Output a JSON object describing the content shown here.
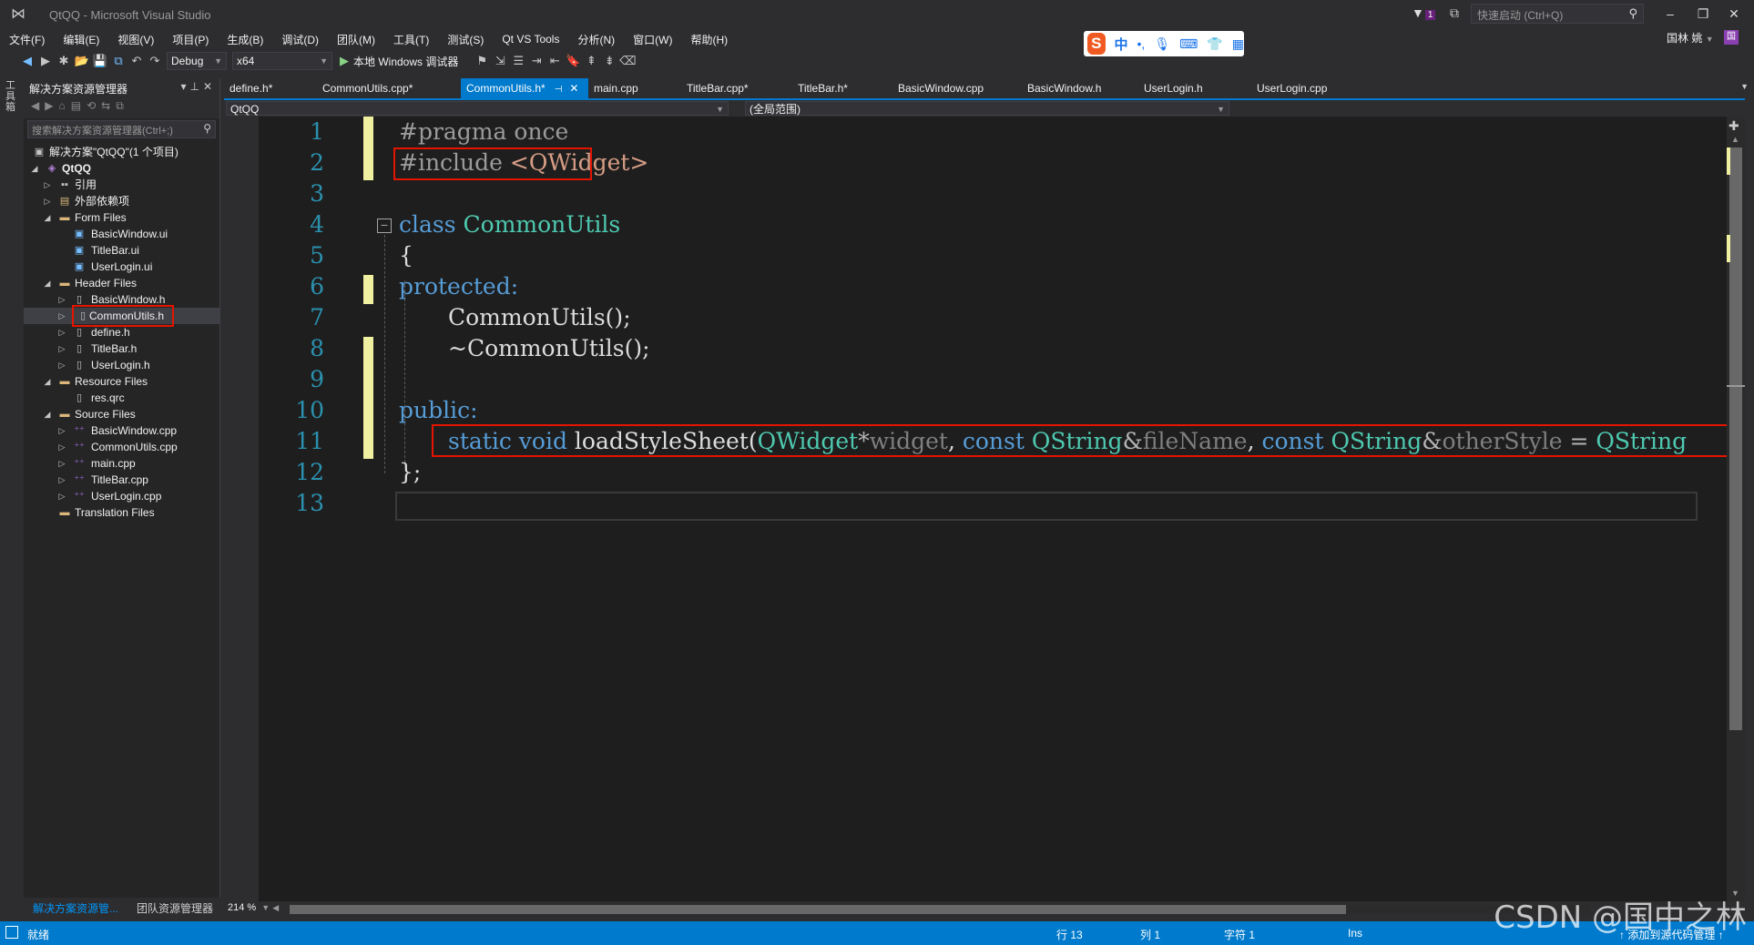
{
  "window": {
    "title": "QtQQ - Microsoft Visual Studio",
    "notification_count": "1",
    "quick_launch_placeholder": "快速启动 (Ctrl+Q)",
    "user_name": "国林 姚",
    "user_initial": "国"
  },
  "menu": [
    "文件(F)",
    "编辑(E)",
    "视图(V)",
    "项目(P)",
    "生成(B)",
    "调试(D)",
    "团队(M)",
    "工具(T)",
    "测试(S)",
    "Qt VS Tools",
    "分析(N)",
    "窗口(W)",
    "帮助(H)"
  ],
  "ime": {
    "logo": "S",
    "mode": "中"
  },
  "toolbar": {
    "config": "Debug",
    "platform": "x64",
    "debugger": "本地 Windows 调试器"
  },
  "side_strip": {
    "label": "工具箱"
  },
  "solution_explorer": {
    "title": "解决方案资源管理器",
    "search_placeholder": "搜索解决方案资源管理器(Ctrl+;)",
    "solution_label": "解决方案\"QtQQ\"(1 个项目)",
    "project": "QtQQ",
    "references": "引用",
    "external_deps": "外部依赖项",
    "form_files": "Form Files",
    "form_items": [
      "BasicWindow.ui",
      "TitleBar.ui",
      "UserLogin.ui"
    ],
    "header_files": "Header Files",
    "header_items": [
      "BasicWindow.h",
      "CommonUtils.h",
      "define.h",
      "TitleBar.h",
      "UserLogin.h"
    ],
    "resource_files": "Resource Files",
    "resource_items": [
      "res.qrc"
    ],
    "source_files": "Source Files",
    "source_items": [
      "BasicWindow.cpp",
      "CommonUtils.cpp",
      "main.cpp",
      "TitleBar.cpp",
      "UserLogin.cpp"
    ],
    "translation_files": "Translation Files",
    "tab_solution": "解决方案资源管...",
    "tab_team": "团队资源管理器"
  },
  "doc_tabs": [
    "define.h*",
    "CommonUtils.cpp*",
    "CommonUtils.h*",
    "main.cpp",
    "TitleBar.cpp*",
    "TitleBar.h*",
    "BasicWindow.cpp",
    "BasicWindow.h",
    "UserLogin.h",
    "UserLogin.cpp"
  ],
  "active_tab": "CommonUtils.h*",
  "navbar": {
    "project": "QtQQ",
    "scope": "(全局范围)"
  },
  "editor": {
    "line_numbers": [
      "1",
      "2",
      "3",
      "4",
      "5",
      "6",
      "7",
      "8",
      "9",
      "10",
      "11",
      "12",
      "13"
    ],
    "line1": "#pragma once",
    "line2_directive": "#include ",
    "line2_header": "<QWidget>",
    "line4_kw": "class",
    "line4_name": "CommonUtils",
    "line5": "{",
    "line6": "protected:",
    "line7": "CommonUtils();",
    "line8": "~CommonUtils();",
    "line10": "public:",
    "line11_static": "static",
    "line11_void": "void",
    "line11_fn": "loadStyleSheet(",
    "line11_type1": "QWidget",
    "line11_star": "*",
    "line11_p1": "widget",
    "line11_comma1": ", ",
    "line11_const1": "const",
    "line11_type2": "QString",
    "line11_amp1": "&",
    "line11_p2": "fileName",
    "line11_comma2": ", ",
    "line11_const2": "const",
    "line11_type3": "QString",
    "line11_amp2": "&",
    "line11_p3": "otherStyle",
    "line11_eq": " = ",
    "line11_type4": "QString",
    "line12": "};",
    "zoom": "214 %"
  },
  "statusbar": {
    "ready": "就绪",
    "row": "行 13",
    "col": "列 1",
    "char": "字符 1",
    "ins": "Ins",
    "source_control": "↑ 添加到源代码管理 ↑"
  },
  "watermark": "CSDN @国中之林",
  "colors": {
    "accent": "#007acc",
    "highlight_box": "#e51400",
    "change_bar": "#eff0a0"
  }
}
